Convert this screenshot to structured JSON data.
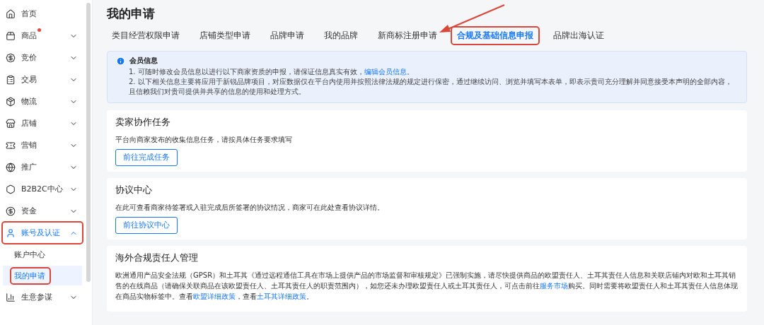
{
  "sidebar": {
    "items": [
      {
        "label": "首页",
        "selected": false
      },
      {
        "label": "商品",
        "selected": false,
        "expanded": false,
        "badge": true
      },
      {
        "label": "竞价",
        "selected": false,
        "expanded": false
      },
      {
        "label": "交易",
        "selected": false,
        "expanded": false
      },
      {
        "label": "物流",
        "selected": false,
        "expanded": false
      },
      {
        "label": "店铺",
        "selected": false,
        "expanded": false
      },
      {
        "label": "营销",
        "selected": false,
        "expanded": false
      },
      {
        "label": "推广",
        "selected": false,
        "expanded": false
      },
      {
        "label": "B2B2C中心",
        "selected": false,
        "expanded": false
      },
      {
        "label": "资金",
        "selected": false,
        "expanded": false
      },
      {
        "label": "账号及认证",
        "selected": true,
        "expanded": true,
        "highlighted": true,
        "children": [
          {
            "label": "账户中心",
            "selected": false,
            "highlighted": false
          },
          {
            "label": "我的申请",
            "selected": true,
            "highlighted": true
          }
        ]
      },
      {
        "label": "生意参谋",
        "selected": false,
        "expanded": false
      }
    ]
  },
  "page_title": "我的申请",
  "tabs": [
    {
      "label": "类目经营权限申请",
      "selected": false,
      "highlighted": false
    },
    {
      "label": "店铺类型申请",
      "selected": false,
      "highlighted": false
    },
    {
      "label": "品牌申请",
      "selected": false,
      "highlighted": false
    },
    {
      "label": "我的品牌",
      "selected": false,
      "highlighted": false
    },
    {
      "label": "新商标注册申请",
      "selected": false,
      "highlighted": false
    },
    {
      "label": "合规及基础信息申报",
      "selected": true,
      "highlighted": true
    },
    {
      "label": "品牌出海认证",
      "selected": false,
      "highlighted": false
    }
  ],
  "notice": {
    "title": "会员信息",
    "lines": [
      [
        {
          "text": "1. 可随时修改会员信息以进行以下商家资质的申报，请保证信息真实有效，"
        },
        {
          "text": "编辑会员信息",
          "link": true
        },
        {
          "text": "。"
        }
      ],
      [
        {
          "text": "2. 以下相关信息主要将应用于新锐品牌项目，对应数据仅在平台内使用并按照法律法规的规定进行保密，通过继续访问、浏览并填写本表单，即表示贵司充分理解并同意接受本声明的全部内容，且信赖我们对贵司提供并共享的信息的使用和处理方式。"
        }
      ]
    ]
  },
  "cards": [
    {
      "title": "卖家协作任务",
      "body": [
        {
          "text": "平台向商家发布的收集信息任务，请按具体任务要求填写"
        }
      ],
      "button": "前往完成任务"
    },
    {
      "title": "协议中心",
      "body": [
        {
          "text": "在此可查看商家待签署或入驻完成后所签署的协议情况，商家可在此处查看协议详情。"
        }
      ],
      "button": "前往协议中心"
    },
    {
      "title": "海外合规责任人管理",
      "body": [
        {
          "text": "欧洲通用产品安全法规（GPSR）和土耳其《通过远程通信工具在市场上提供产品的市场监督和审核规定》已强制实施，请尽快提供商品的欧盟责任人、土耳其责任人信息和关联店铺内对欧和土耳其销售的在线商品（请确保关联商品在该欧盟责任人、土耳其责任人的职责范围内），如您还未办理欧盟责任人或土耳其责任人，可点击前往"
        },
        {
          "text": "服务市场",
          "link": true
        },
        {
          "text": "购买。同时需要将欧盟责任人和土耳其责任人信息体现在商品实物标签中。查看"
        },
        {
          "text": "欧盟详细政策",
          "link": true
        },
        {
          "text": "，查看"
        },
        {
          "text": "土耳其详细政策",
          "link": true
        },
        {
          "text": "。"
        }
      ]
    }
  ]
}
